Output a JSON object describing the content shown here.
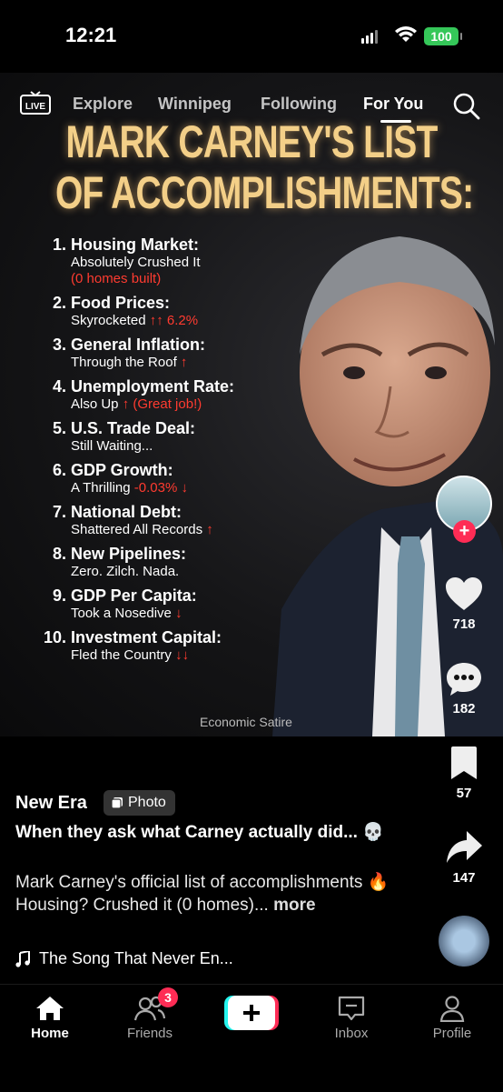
{
  "status": {
    "time": "12:21",
    "battery": "100"
  },
  "nav": {
    "tabs": [
      {
        "label": "Explore"
      },
      {
        "label": "Winnipeg"
      },
      {
        "label": "Following"
      },
      {
        "label": "For You"
      }
    ],
    "live_label": "LIVE"
  },
  "post": {
    "headline": [
      "MARK CARNEY'S LIST",
      "OF ACCOMPLISHMENTS:"
    ],
    "items": [
      {
        "num": "1.",
        "title": "Housing Market:",
        "sub": "Absolutely Crushed It",
        "extra": "(0 homes built)"
      },
      {
        "num": "2.",
        "title": "Food Prices:",
        "sub": "Skyrocketed ",
        "red": "↑↑ 6.2%"
      },
      {
        "num": "3.",
        "title": "General Inflation:",
        "sub": "Through the Roof ",
        "red": "↑"
      },
      {
        "num": "4.",
        "title": "Unemployment Rate:",
        "sub": "Also Up ",
        "red": "↑ (Great job!)"
      },
      {
        "num": "5.",
        "title": "U.S. Trade Deal:",
        "sub": "Still Waiting...",
        "red": ""
      },
      {
        "num": "6.",
        "title": "GDP Growth:",
        "sub": "A Thrilling ",
        "red": "-0.03% ↓"
      },
      {
        "num": "7.",
        "title": "National Debt:",
        "sub": "Shattered All Records ",
        "red": "↑"
      },
      {
        "num": "8.",
        "title": "New Pipelines:",
        "sub": "Zero. Zilch. Nada.",
        "red": ""
      },
      {
        "num": "9.",
        "title": "GDP Per Capita:",
        "sub": "Took a Nosedive ",
        "red": "↓"
      },
      {
        "num": "10.",
        "title": "Investment Capital:",
        "sub": "Fled the Country ",
        "red": "↓↓"
      }
    ],
    "watermark": "Economic Satire"
  },
  "rail": {
    "likes": "718",
    "comments": "182",
    "saves": "57",
    "shares": "147"
  },
  "caption": {
    "username": "New Era",
    "badge": "Photo",
    "title": "When they ask what Carney actually did... 💀",
    "desc": "Mark Carney's official list of accomplishments 🔥",
    "desc2": "Housing? Crushed it (0 homes)... ",
    "more": "more",
    "music": "The Song That Never En..."
  },
  "tabbar": {
    "home": "Home",
    "friends": "Friends",
    "friends_badge": "3",
    "inbox": "Inbox",
    "profile": "Profile"
  },
  "colors": {
    "accent": "#fe2c55",
    "headline": "#f3cf88",
    "red": "#ff3b30",
    "battery": "#35c759"
  }
}
